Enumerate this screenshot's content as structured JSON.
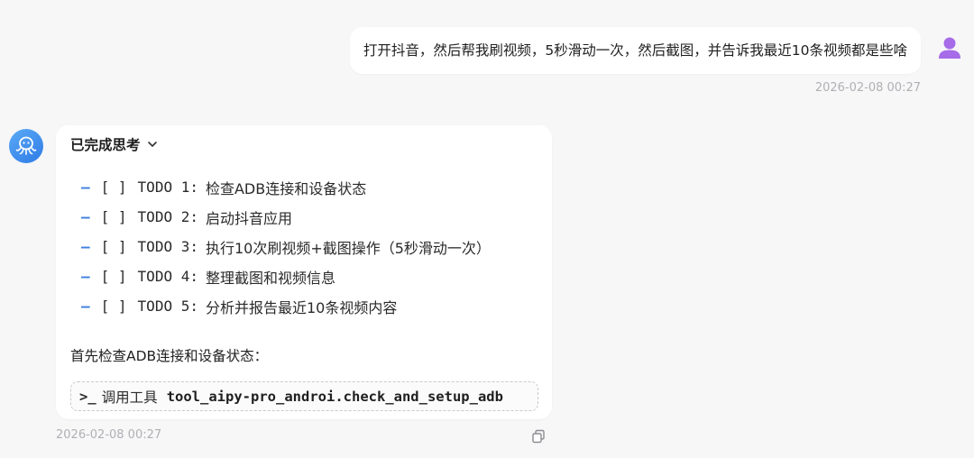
{
  "user_message": {
    "text": "打开抖音，然后帮我刷视频，5秒滑动一次，然后截图，并告诉我最近10条视频都是些啥",
    "time": "2026-02-08 00:27"
  },
  "assistant_message": {
    "thinking_label": "已完成思考",
    "todos": [
      {
        "check": "[ ]",
        "label": "TODO 1:",
        "text": "检查ADB连接和设备状态"
      },
      {
        "check": "[ ]",
        "label": "TODO 2:",
        "text": "启动抖音应用"
      },
      {
        "check": "[ ]",
        "label": "TODO 3:",
        "text": "执行10次刷视频+截图操作（5秒滑动一次）"
      },
      {
        "check": "[ ]",
        "label": "TODO 4:",
        "text": "整理截图和视频信息"
      },
      {
        "check": "[ ]",
        "label": "TODO 5:",
        "text": "分析并报告最近10条视频内容"
      }
    ],
    "intro_text": "首先检查ADB连接和设备状态：",
    "tool_call": {
      "prompt": ">_",
      "prefix": "调用工具",
      "name": "tool_aipy-pro_androi.check_and_setup_adb"
    },
    "time": "2026-02-08 00:27"
  },
  "icons": {
    "user_avatar": "user-icon",
    "bot_avatar": "octopus-icon",
    "thinking_toggle": "chevron-down-icon",
    "copy": "copy-icon"
  },
  "colors": {
    "background": "#f7f7f8",
    "accent": "#3f7fe0",
    "user_avatar": "#a76ce8",
    "bot_avatar": "#3a88ee"
  }
}
